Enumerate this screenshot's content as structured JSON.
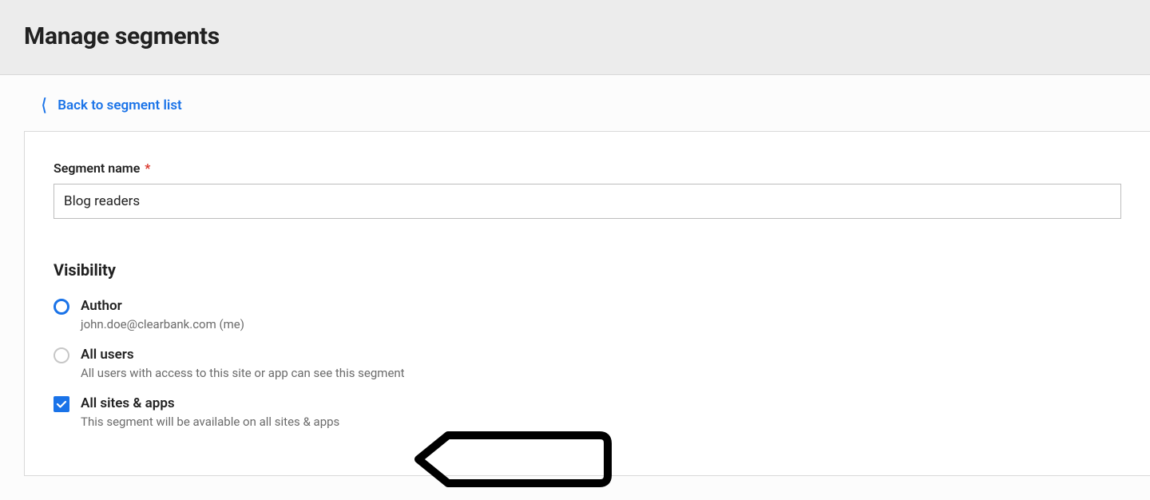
{
  "header": {
    "title": "Manage segments"
  },
  "nav": {
    "back_label": "Back to segment list"
  },
  "form": {
    "segment_name_label": "Segment name",
    "segment_name_value": "Blog readers"
  },
  "visibility": {
    "heading": "Visibility",
    "options": [
      {
        "title": "Author",
        "desc": "john.doe@clearbank.com (me)",
        "selected": true,
        "control": "radio"
      },
      {
        "title": "All users",
        "desc": "All users with access to this site or app can see this segment",
        "selected": false,
        "control": "radio"
      },
      {
        "title": "All sites & apps",
        "desc": "This segment will be available on all sites & apps",
        "selected": true,
        "control": "checkbox"
      }
    ]
  }
}
